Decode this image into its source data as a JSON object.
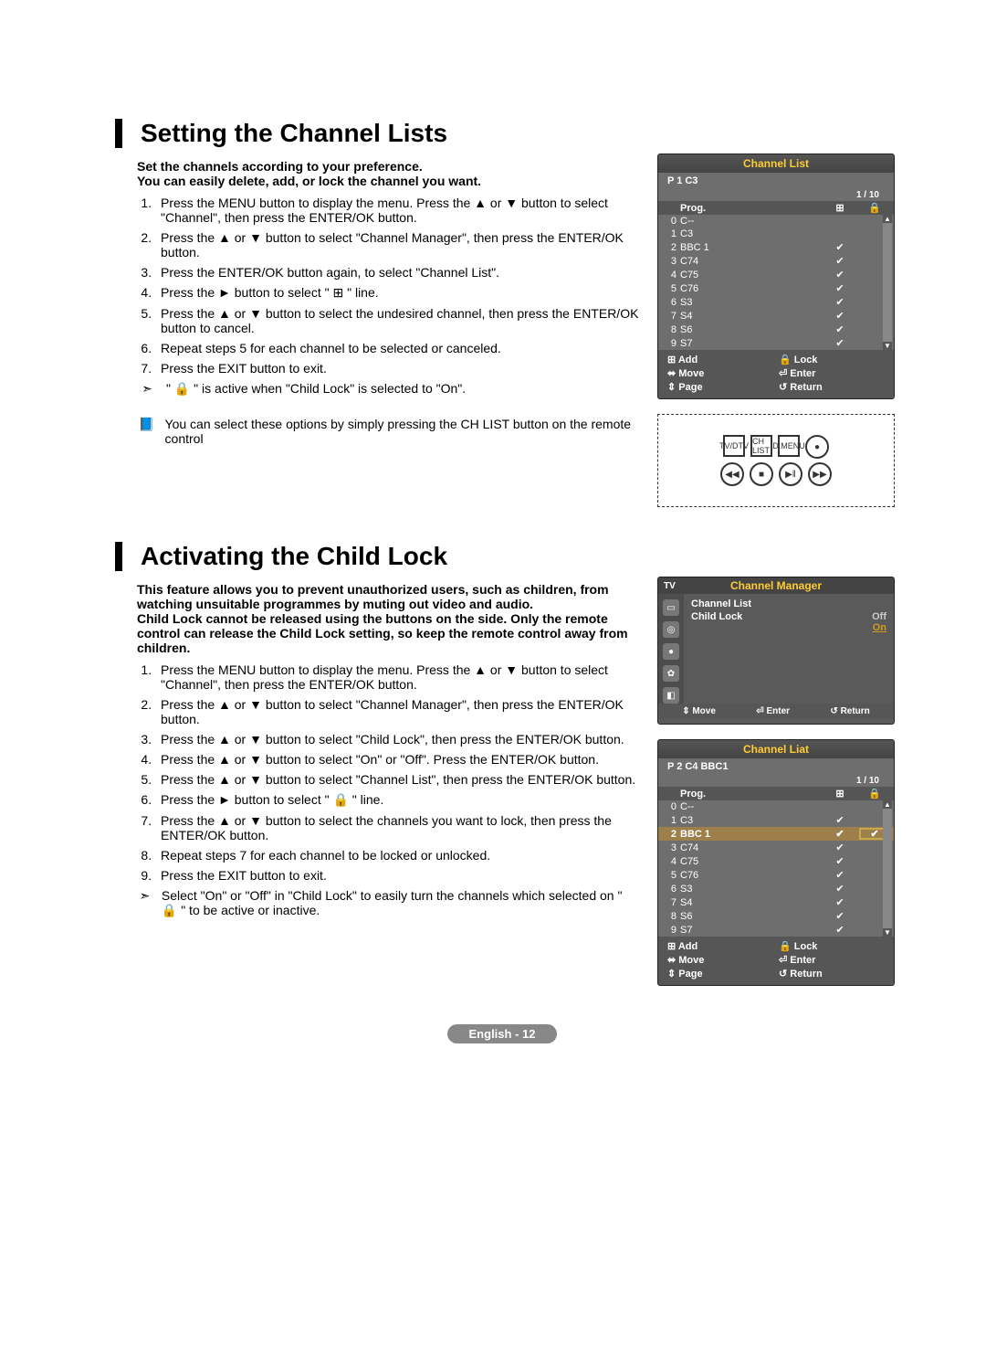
{
  "footer": "English - 12",
  "section1": {
    "title": "Setting the Channel Lists",
    "intro1": "Set the channels according to your preference.",
    "intro2": "You can easily delete, add, or lock the channel you want.",
    "steps": [
      "Press the MENU button to display the menu. Press the ▲ or ▼ button to select \"Channel\", then press the ENTER/OK button.",
      "Press the ▲ or ▼ button to select \"Channel Manager\", then press the ENTER/OK button.",
      "Press the ENTER/OK button again, to select \"Channel List\".",
      "Press the ► button to select \" ⊞ \" line.",
      "Press the ▲ or ▼ button to select the undesired channel, then press the ENTER/OK button to cancel.",
      "Repeat steps 5 for each channel to be selected or canceled.",
      "Press the EXIT button to exit."
    ],
    "note1_glyph": "➣",
    "note1": "\" 🔒 \" is active when \"Child Lock\" is selected to \"On\".",
    "note2_glyph": "📘",
    "note2": "You can select these options by simply pressing the CH LIST button on the remote control"
  },
  "section2": {
    "title": "Activating the Child Lock",
    "intro": "This feature allows you to prevent unauthorized users, such as children, from watching unsuitable programmes by muting out video and audio.\nChild Lock cannot be released using the buttons on the side. Only the remote control can release the Child Lock setting, so keep the remote control away from children.",
    "steps": [
      "Press the MENU button to display the menu. Press the ▲ or ▼ button to select \"Channel\", then press the ENTER/OK button.",
      "Press the ▲ or ▼ button to select \"Channel Manager\", then press the ENTER/OK button.",
      "Press the ▲ or ▼ button to select \"Child Lock\", then press the ENTER/OK button.",
      "Press the ▲ or ▼ button to select \"On\" or \"Off\". Press the ENTER/OK button.",
      "Press the ▲ or ▼ button to select \"Channel List\", then press the ENTER/OK button.",
      "Press the ► button to select \" 🔒 \" line.",
      "Press the ▲ or ▼ button to select the channels you want to lock, then press the ENTER/OK button.",
      "Repeat steps 7 for each channel to be locked or unlocked.",
      "Press the EXIT button to exit."
    ],
    "note_glyph": "➣",
    "note": "Select \"On\" or \"Off\" in \"Child Lock\" to easily turn the channels which selected on \" 🔒 \" to be active or inactive."
  },
  "osd1": {
    "title": "Channel List",
    "current": "P  1  C3",
    "pager": "1 / 10",
    "hdr_prog": "Prog.",
    "rows": [
      {
        "n": "0",
        "name": "C--",
        "add": "",
        "lock": ""
      },
      {
        "n": "1",
        "name": "C3",
        "add": "",
        "lock": ""
      },
      {
        "n": "2",
        "name": "BBC 1",
        "add": "✔",
        "lock": ""
      },
      {
        "n": "3",
        "name": "C74",
        "add": "✔",
        "lock": ""
      },
      {
        "n": "4",
        "name": "C75",
        "add": "✔",
        "lock": ""
      },
      {
        "n": "5",
        "name": "C76",
        "add": "✔",
        "lock": ""
      },
      {
        "n": "6",
        "name": "S3",
        "add": "✔",
        "lock": ""
      },
      {
        "n": "7",
        "name": "S4",
        "add": "✔",
        "lock": ""
      },
      {
        "n": "8",
        "name": "S6",
        "add": "✔",
        "lock": ""
      },
      {
        "n": "9",
        "name": "S7",
        "add": "✔",
        "lock": ""
      }
    ],
    "cmds": {
      "add": "⊞ Add",
      "lock": "🔒 Lock",
      "move": "⬌ Move",
      "enter": "⏎ Enter",
      "page": "⇕ Page",
      "return": "↺ Return"
    }
  },
  "remote": {
    "labels": [
      "TV/DTV",
      "CH LIST",
      "D.MENU",
      "REC",
      "REW",
      "STOP",
      "PLAY/PAUSE",
      "FF"
    ]
  },
  "mgr": {
    "title": "Channel Manager",
    "tv": "TV",
    "items": [
      {
        "label": "Channel List",
        "value": ""
      },
      {
        "label": "Child Lock",
        "value": "Off",
        "opts": [
          "Off",
          "On"
        ]
      }
    ],
    "bar": {
      "move": "⇕ Move",
      "enter": "⏎ Enter",
      "return": "↺ Return"
    }
  },
  "osd2": {
    "title": "Channel Liat",
    "current": "P  2  C4      BBC1",
    "pager": "1 / 10",
    "hdr_prog": "Prog.",
    "rows": [
      {
        "n": "0",
        "name": "C--",
        "add": "",
        "lock": ""
      },
      {
        "n": "1",
        "name": "C3",
        "add": "✔",
        "lock": ""
      },
      {
        "n": "2",
        "name": "BBC 1",
        "add": "✔",
        "lock": "✔"
      },
      {
        "n": "3",
        "name": "C74",
        "add": "✔",
        "lock": ""
      },
      {
        "n": "4",
        "name": "C75",
        "add": "✔",
        "lock": ""
      },
      {
        "n": "5",
        "name": "C76",
        "add": "✔",
        "lock": ""
      },
      {
        "n": "6",
        "name": "S3",
        "add": "✔",
        "lock": ""
      },
      {
        "n": "7",
        "name": "S4",
        "add": "✔",
        "lock": ""
      },
      {
        "n": "8",
        "name": "S6",
        "add": "✔",
        "lock": ""
      },
      {
        "n": "9",
        "name": "S7",
        "add": "✔",
        "lock": ""
      }
    ],
    "cmds": {
      "add": "⊞ Add",
      "lock": "🔒 Lock",
      "move": "⬌ Move",
      "enter": "⏎ Enter",
      "page": "⇕ Page",
      "return": "↺ Return"
    }
  }
}
